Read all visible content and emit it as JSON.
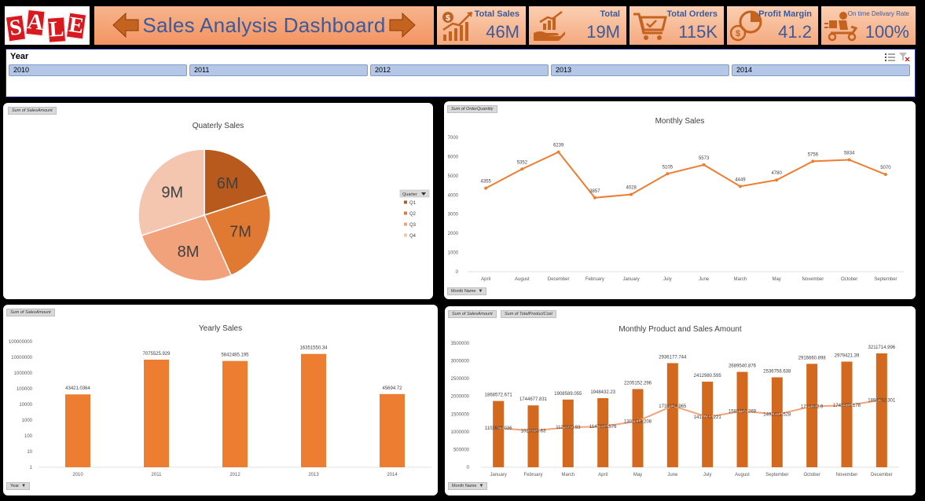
{
  "header": {
    "logo_text": "SALE",
    "title": "Sales Analysis Dashboard"
  },
  "kpis": [
    {
      "label": "Total Sales",
      "value": "46M",
      "icon": "growth-chart-icon",
      "badge": "$"
    },
    {
      "label": "Total",
      "value": "19M",
      "icon": "hand-money-growth-icon"
    },
    {
      "label": "Total Orders",
      "value": "115K",
      "icon": "shopping-cart-icon"
    },
    {
      "label": "Profit Margin",
      "value": "41.2",
      "icon": "profit-pie-coin-icon"
    },
    {
      "label": "On time Delivary Rate",
      "value": "100%",
      "icon": "delivery-scooter-icon"
    }
  ],
  "slicer": {
    "title": "Year",
    "items": [
      "2010",
      "2011",
      "2012",
      "2013",
      "2014"
    ]
  },
  "colors": {
    "accent": "#ed7d31",
    "dark_orange": "#d2691e",
    "header_orange": "#f39462",
    "title_blue": "#3c5a9a",
    "slicer_blue": "#b4c7e7"
  },
  "panels": {
    "quarterly": {
      "field_tag": "Sum of SalesAmount",
      "legend_filter": "Quarter"
    },
    "monthly": {
      "field_tag": "Sum of OrderQuantity",
      "axis_filter": "Month Name"
    },
    "yearly": {
      "field_tag": "Sum of SalesAmount",
      "axis_filter": "Year"
    },
    "product": {
      "field_tags": [
        "Sum of SalesAmount",
        "Sum of TotalProductCost"
      ],
      "axis_filter": "Month Name"
    }
  },
  "chart_data": [
    {
      "type": "pie",
      "title": "Quaterly Sales",
      "categories": [
        "Q1",
        "Q2",
        "Q3",
        "Q4"
      ],
      "values": [
        6,
        7,
        8,
        9
      ],
      "data_labels": [
        "6M",
        "7M",
        "8M",
        "9M"
      ],
      "colors": [
        "#b85a1d",
        "#e07a32",
        "#f2a27a",
        "#f4c6b0"
      ],
      "legend": "right"
    },
    {
      "type": "line",
      "title": "Monthly Sales",
      "categories": [
        "April",
        "August",
        "December",
        "February",
        "January",
        "July",
        "June",
        "March",
        "May",
        "November",
        "October",
        "September"
      ],
      "values": [
        4355,
        5352,
        6239,
        3857,
        4028,
        5105,
        5573,
        4449,
        4780,
        5756,
        5834,
        5070
      ],
      "ylim": [
        0,
        7000
      ],
      "yticks": [
        0,
        1000,
        2000,
        3000,
        4000,
        5000,
        6000,
        7000
      ],
      "color": "#ed7d31"
    },
    {
      "type": "bar",
      "title": "Yearly Sales",
      "categories": [
        "2010",
        "2011",
        "2012",
        "2013",
        "2014"
      ],
      "values": [
        43421.0364,
        7075525.929,
        5842485.195,
        16351550.34,
        45694.72
      ],
      "data_labels": [
        "43421.0364",
        "7075525.929",
        "5842485.195",
        "16351550.34",
        "45694.72"
      ],
      "yscale": "log",
      "yticks": [
        "1",
        "10",
        "100",
        "1000",
        "10000",
        "100000",
        "1000000",
        "10000000",
        "100000000"
      ],
      "color": "#ed7d31"
    },
    {
      "type": "bar",
      "title": "Monthly Product and Sales Amount",
      "categories": [
        "January",
        "February",
        "March",
        "April",
        "May",
        "June",
        "July",
        "August",
        "September",
        "October",
        "November",
        "December"
      ],
      "series": [
        {
          "name": "Sum of SalesAmount",
          "type": "bar",
          "values": [
            1868572.671,
            1744677.831,
            1908589.055,
            1948432.23,
            2205152.296,
            2936177.744,
            2412980.595,
            2689540.876,
            2536756.638,
            2916660.898,
            2979421.39,
            3211714.996
          ],
          "labels": [
            "1868572.671",
            "1744677.831",
            "1908589.055",
            "1948432.23",
            "2205152.296",
            "2936177.744",
            "2412980.595",
            "2689540.876",
            "2536756.638",
            "2916660.898",
            "2979421.39",
            "3211714.996"
          ]
        },
        {
          "name": "Sum of TotalProductCost",
          "type": "line",
          "values": [
            1102629.036,
            1029856.63,
            1125849.93,
            1147859.576,
            1301413.208,
            1731234.965,
            1417749.221,
            1583754.269,
            1491621.528,
            1716362.9,
            1745370.178,
            1894092.301
          ],
          "labels": [
            "1102629.036",
            "1029856.63",
            "1125849.93",
            "1147859.576",
            "1301413.208",
            "1731234.965",
            "1417749.221",
            "1583754.269",
            "1491621.528",
            "1716362.9",
            "1745370.178",
            "1894092.301"
          ]
        }
      ],
      "ylim": [
        0,
        3500000
      ],
      "yticks": [
        0,
        500000,
        1000000,
        1500000,
        2000000,
        2500000,
        3000000,
        3500000
      ],
      "colors": [
        "#d2691e",
        "#f2a27a"
      ]
    }
  ]
}
